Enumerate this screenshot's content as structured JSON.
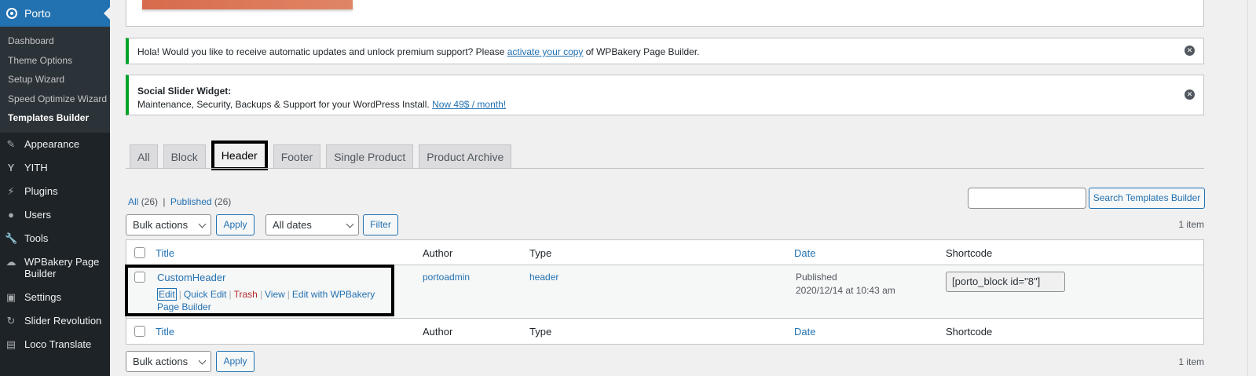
{
  "sidebar": {
    "current_menu": "Porto",
    "submenu": [
      "Dashboard",
      "Theme Options",
      "Setup Wizard",
      "Speed Optimize Wizard",
      "Templates Builder"
    ],
    "items": [
      {
        "label": "Appearance",
        "icon": "paintbrush-icon"
      },
      {
        "label": "YITH",
        "icon": "yith-icon"
      },
      {
        "label": "Plugins",
        "icon": "plug-icon"
      },
      {
        "label": "Users",
        "icon": "user-icon"
      },
      {
        "label": "Tools",
        "icon": "wrench-icon"
      },
      {
        "label": "WPBakery Page Builder",
        "icon": "cloud-icon"
      },
      {
        "label": "Settings",
        "icon": "settings-icon"
      },
      {
        "label": "Slider Revolution",
        "icon": "refresh-icon"
      },
      {
        "label": "Loco Translate",
        "icon": "translate-icon"
      }
    ]
  },
  "notices": {
    "update": {
      "before": "Hola! Would you like to receive automatic updates and unlock premium support? Please ",
      "link": "activate your copy",
      "after": " of WPBakery Page Builder."
    },
    "social": {
      "title": "Social Slider Widget:",
      "text": "Maintenance, Security, Backups & Support for your WordPress Install. ",
      "link": "Now 49$ / month!"
    }
  },
  "tabs": [
    "All",
    "Block",
    "Header",
    "Footer",
    "Single Product",
    "Product Archive"
  ],
  "active_tab": "Header",
  "filters": {
    "all": "All",
    "all_count": "(26)",
    "sep": "|",
    "published": "Published",
    "published_count": "(26)",
    "search_button": "Search Templates Builder",
    "bulk_actions": "Bulk actions",
    "apply": "Apply",
    "all_dates": "All dates",
    "filter": "Filter",
    "items_count": "1 item"
  },
  "table": {
    "columns": {
      "title": "Title",
      "author": "Author",
      "type": "Type",
      "date": "Date",
      "shortcode": "Shortcode"
    },
    "rows": [
      {
        "title": "CustomHeader",
        "actions": {
          "edit": "Edit",
          "quick_edit": "Quick Edit",
          "trash": "Trash",
          "view": "View",
          "edit_wpb": "Edit with WPBakery Page Builder"
        },
        "author": "portoadmin",
        "type": "header",
        "date_status": "Published",
        "date": "2020/12/14 at 10:43 am",
        "shortcode": "[porto_block id=\"8\"]"
      }
    ]
  }
}
